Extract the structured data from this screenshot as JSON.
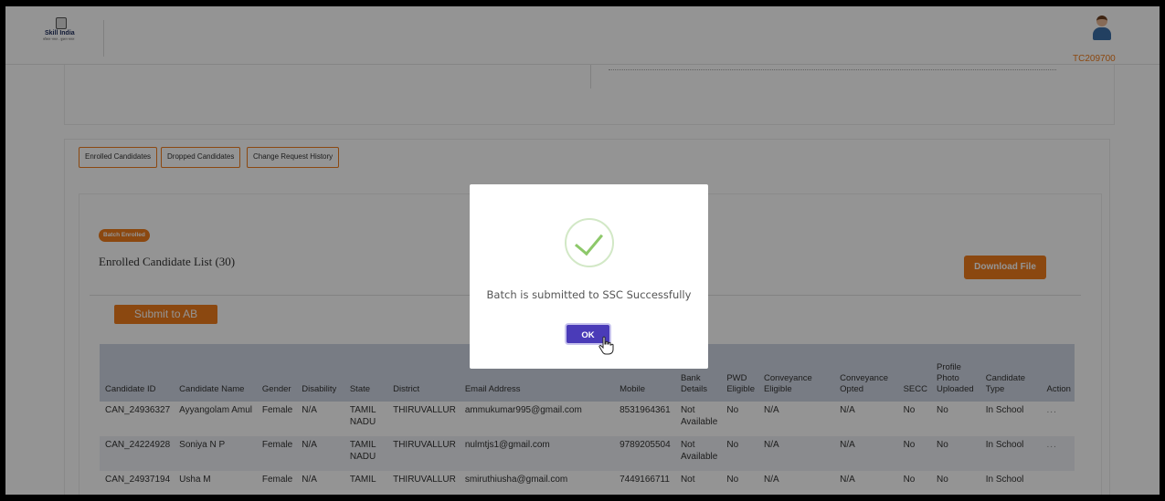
{
  "header": {
    "logo_text": "Skill India",
    "logo_subtext": "कौशल भारत - कुशल भारत",
    "user_id": "TC209700"
  },
  "tabs": [
    {
      "label": "Enrolled Candidates"
    },
    {
      "label": "Dropped Candidates"
    },
    {
      "label": "Change Request History"
    }
  ],
  "batch_badge": "Batch Enrolled",
  "list_title": "Enrolled Candidate List (30)",
  "download_label": "Download File",
  "submit_label": "Submit to AB",
  "table": {
    "columns": [
      "Candidate ID",
      "Candidate Name",
      "Gender",
      "Disability",
      "State",
      "District",
      "Email Address",
      "Mobile",
      "Bank Details",
      "PWD Eligible",
      "Conveyance Eligible",
      "Conveyance Opted",
      "SECC",
      "Profile Photo Uploaded",
      "Candidate Type",
      "Action"
    ],
    "rows": [
      [
        "CAN_24936327",
        "Ayyangolam Amul",
        "Female",
        "N/A",
        "TAMIL NADU",
        "THIRUVALLUR",
        "ammukumar995@gmail.com",
        "8531964361",
        "Not Available",
        "No",
        "N/A",
        "N/A",
        "No",
        "No",
        "In School",
        "..."
      ],
      [
        "CAN_24224928",
        "Soniya N P",
        "Female",
        "N/A",
        "TAMIL NADU",
        "THIRUVALLUR",
        "nulmtjs1@gmail.com",
        "9789205504",
        "Not Available",
        "No",
        "N/A",
        "N/A",
        "No",
        "No",
        "In School",
        "..."
      ],
      [
        "CAN_24937194",
        "Usha M",
        "Female",
        "N/A",
        "TAMIL",
        "THIRUVALLUR",
        "smiruthiusha@gmail.com",
        "7449166711",
        "Not",
        "No",
        "N/A",
        "N/A",
        "No",
        "No",
        "In School",
        ""
      ]
    ]
  },
  "modal": {
    "message": "Batch is submitted to SSC Successfully",
    "ok_label": "OK",
    "icon": "check-icon"
  },
  "colors": {
    "accent": "#f07c1c",
    "ok_button": "#4a3bb8",
    "table_header": "#cfd6e3",
    "success": "#8dc86a"
  }
}
